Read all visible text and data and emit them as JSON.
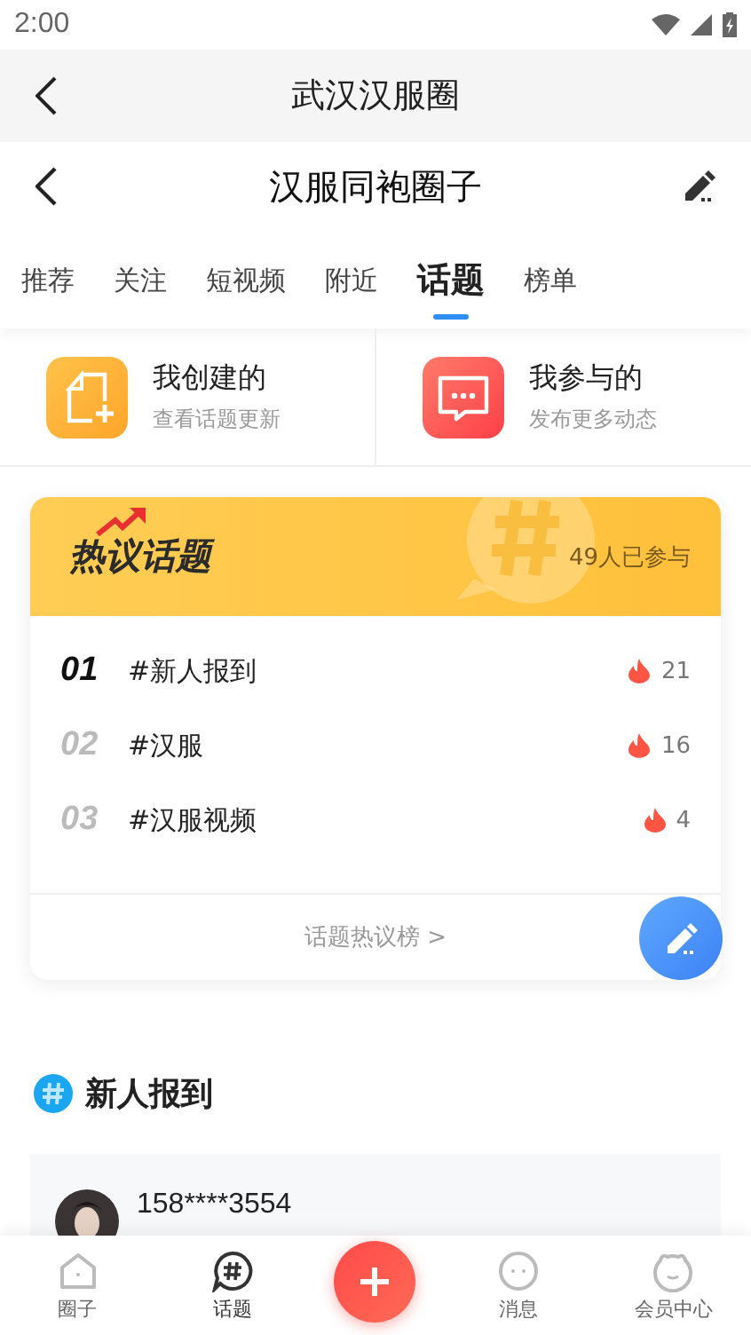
{
  "status_bar": {
    "time": "2:00"
  },
  "top_bar": {
    "title": "武汉汉服圈"
  },
  "circle_header": {
    "title": "汉服同袍圈子"
  },
  "tabs": [
    {
      "label": "推荐",
      "selected": false
    },
    {
      "label": "关注",
      "selected": false
    },
    {
      "label": "短视频",
      "selected": false
    },
    {
      "label": "附近",
      "selected": false
    },
    {
      "label": "话题",
      "selected": true
    },
    {
      "label": "榜单",
      "selected": false
    }
  ],
  "shortcuts": [
    {
      "kind": "create",
      "title": "我创建的",
      "subtitle": "查看话题更新"
    },
    {
      "kind": "join",
      "title": "我参与的",
      "subtitle": "发布更多动态"
    }
  ],
  "hot_topics": {
    "title": "热议话题",
    "participants": "49人已参与",
    "items": [
      {
        "rank": "01",
        "name": "#新人报到",
        "heat": "21",
        "highlighted": true
      },
      {
        "rank": "02",
        "name": "#汉服",
        "heat": "16",
        "highlighted": false
      },
      {
        "rank": "03",
        "name": "#汉服视频",
        "heat": "4",
        "highlighted": false
      }
    ],
    "footer": "话题热议榜 >"
  },
  "section": {
    "title": "新人报到"
  },
  "post": {
    "user": "158****3554"
  },
  "bottom_nav": [
    {
      "kind": "home",
      "label": "圈子",
      "selected": false
    },
    {
      "kind": "topic",
      "label": "话题",
      "selected": true
    },
    {
      "kind": "add"
    },
    {
      "kind": "message",
      "label": "消息",
      "selected": false
    },
    {
      "kind": "member",
      "label": "会员中心",
      "selected": false
    }
  ]
}
